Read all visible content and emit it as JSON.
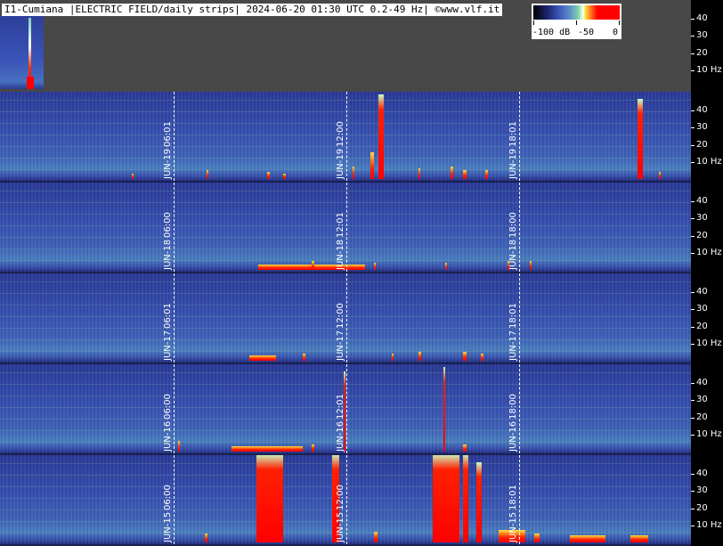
{
  "header": {
    "title": "I1-Cumiana |ELECTRIC FIELD/daily strips| 2024-06-20 01:30 UTC 0.2-49 Hz| ©www.vlf.it"
  },
  "colorbar": {
    "labels": [
      "-100 dB",
      "-50",
      "0"
    ],
    "colors": [
      "#000000",
      "#3d57b8",
      "#7fd0b0",
      "#ffffff",
      "#ffe040",
      "#ff0000"
    ]
  },
  "chart_data": {
    "type": "heatmap",
    "title": "I1-Cumiana |ELECTRIC FIELD/daily strips| 2024-06-20 01:30 UTC 0.2-49 Hz| ©www.vlf.it",
    "frequency_range_hz": [
      0.2,
      49
    ],
    "y_ticks": [
      {
        "value": 40,
        "label": "40"
      },
      {
        "value": 30,
        "label": "30"
      },
      {
        "value": 20,
        "label": "20"
      },
      {
        "value": 10,
        "label": "10 Hz"
      }
    ],
    "intensity_scale_db": [
      -100,
      0
    ],
    "strips": [
      {
        "day": "JUN-20",
        "markers": []
      },
      {
        "day": "JUN-19",
        "markers": [
          {
            "text": "06:01",
            "day_text": "JUN-19",
            "hour": 6.0
          },
          {
            "text": "12:00",
            "day_text": "JUN-19",
            "hour": 12.0
          },
          {
            "text": "18:01",
            "day_text": "JUN-19",
            "hour": 18.0
          }
        ]
      },
      {
        "day": "JUN-18",
        "markers": [
          {
            "text": "06:00",
            "day_text": "JUN-18",
            "hour": 6.0
          },
          {
            "text": "12:01",
            "day_text": "JUN-18",
            "hour": 12.0
          },
          {
            "text": "18:00",
            "day_text": "JUN-18",
            "hour": 18.0
          }
        ]
      },
      {
        "day": "JUN-17",
        "markers": [
          {
            "text": "06:01",
            "day_text": "JUN-17",
            "hour": 6.0
          },
          {
            "text": "12:00",
            "day_text": "JUN-17",
            "hour": 12.0
          },
          {
            "text": "18:01",
            "day_text": "JUN-17",
            "hour": 18.0
          }
        ]
      },
      {
        "day": "JUN-16",
        "markers": [
          {
            "text": "06:00",
            "day_text": "JUN-16",
            "hour": 6.0
          },
          {
            "text": "12:01",
            "day_text": "JUN-16",
            "hour": 12.0
          },
          {
            "text": "18:00",
            "day_text": "JUN-16",
            "hour": 18.0
          }
        ]
      },
      {
        "day": "JUN-15",
        "markers": [
          {
            "text": "06:00",
            "day_text": "JUN-15",
            "hour": 6.0
          },
          {
            "text": "12:00",
            "day_text": "JUN-15",
            "hour": 12.0
          },
          {
            "text": "18:01",
            "day_text": "JUN-15",
            "hour": 18.0
          }
        ]
      }
    ]
  }
}
